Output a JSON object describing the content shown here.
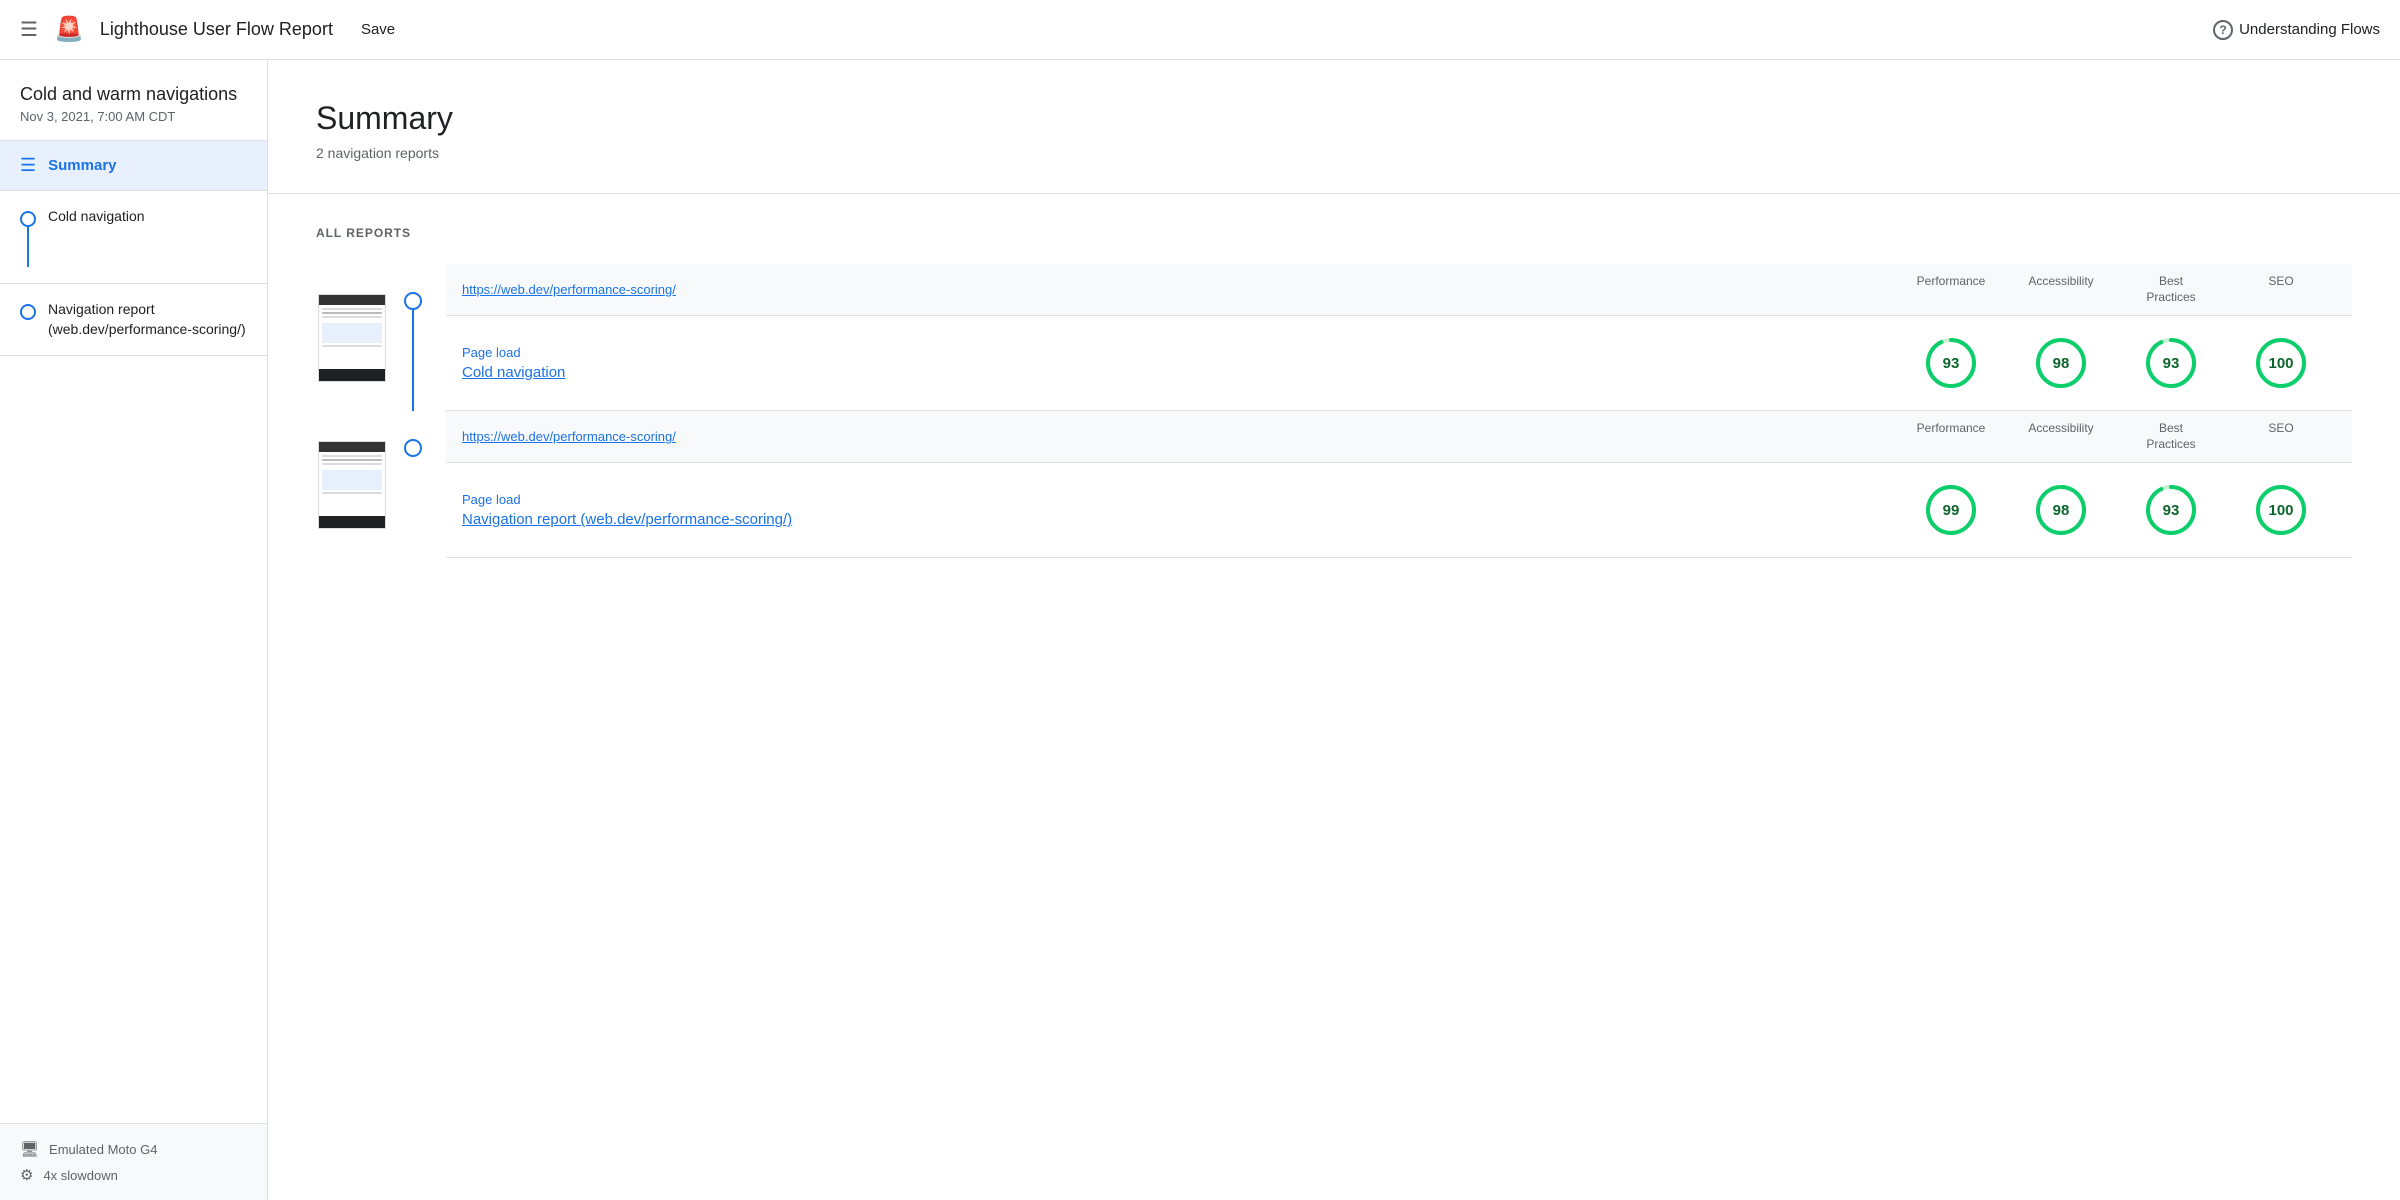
{
  "header": {
    "menu_label": "☰",
    "logo": "🚨",
    "title": "Lighthouse User Flow Report",
    "save_label": "Save",
    "understanding_label": "Understanding Flows"
  },
  "sidebar": {
    "project_name": "Cold and warm navigations",
    "project_date": "Nov 3, 2021, 7:00 AM CDT",
    "summary_label": "Summary",
    "nav_items": [
      {
        "label": "Cold navigation",
        "has_line": true
      },
      {
        "label": "Navigation report (web.dev/performance-scoring/)",
        "has_line": false
      }
    ],
    "device_info": [
      {
        "icon": "🖥",
        "label": "Emulated Moto G4"
      },
      {
        "icon": "⚙",
        "label": "4x slowdown"
      }
    ]
  },
  "main": {
    "summary_heading": "Summary",
    "summary_sub": "2 navigation reports",
    "all_reports_label": "ALL REPORTS",
    "reports": [
      {
        "url": "https://web.dev/performance-scoring/",
        "type_label": "Page load",
        "name": "Cold navigation",
        "scores": [
          {
            "label": "Performance",
            "value": 93,
            "pct": 0.93
          },
          {
            "label": "Accessibility",
            "value": 98,
            "pct": 0.98
          },
          {
            "label": "Best Practices",
            "value": 93,
            "pct": 0.93
          },
          {
            "label": "SEO",
            "value": 100,
            "pct": 1.0
          }
        ]
      },
      {
        "url": "https://web.dev/performance-scoring/",
        "type_label": "Page load",
        "name": "Navigation report (web.dev/performance-scoring/)",
        "scores": [
          {
            "label": "Performance",
            "value": 99,
            "pct": 0.99
          },
          {
            "label": "Accessibility",
            "value": 98,
            "pct": 0.98
          },
          {
            "label": "Best Practices",
            "value": 93,
            "pct": 0.93
          },
          {
            "label": "SEO",
            "value": 100,
            "pct": 1.0
          }
        ]
      }
    ]
  }
}
